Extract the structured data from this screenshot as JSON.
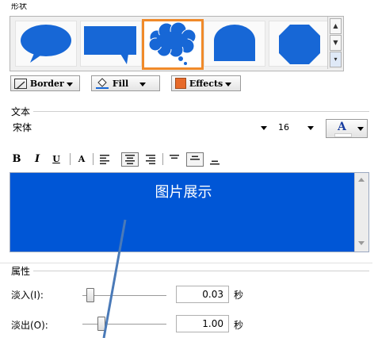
{
  "shape_section": {
    "label": "形状"
  },
  "gallery": {
    "shapes": [
      {
        "name": "oval-callout"
      },
      {
        "name": "rect-callout"
      },
      {
        "name": "cloud-callout",
        "selected": true
      },
      {
        "name": "round-rect-shape"
      },
      {
        "name": "octagon-shape"
      }
    ],
    "scroll_up": "▲",
    "scroll_down": "▼",
    "scroll_more": "▾"
  },
  "toolbar": {
    "border_label": "Border",
    "fill_label": "Fill",
    "effects_label": "Effects"
  },
  "text_section": {
    "label": "文本",
    "font_name": "宋体",
    "font_size": "16",
    "color_button_label": "A"
  },
  "format_bar": {
    "bold": "B",
    "italic": "I",
    "underline": "U",
    "font_color": "A"
  },
  "textarea": {
    "content": "图片展示",
    "background_color": "#0056d6",
    "text_color": "#ffffff"
  },
  "properties": {
    "label": "属性",
    "fade_in": {
      "label": "淡入(I):",
      "value": "0.03",
      "unit": "秒",
      "level": 0.05
    },
    "fade_out": {
      "label": "淡出(O):",
      "value": "1.00",
      "unit": "秒",
      "level": 0.2
    }
  },
  "colors": {
    "accent_selection": "#f08a2a",
    "shape_blue": "#1767d6",
    "annotation_line": "#4a7ab8"
  }
}
